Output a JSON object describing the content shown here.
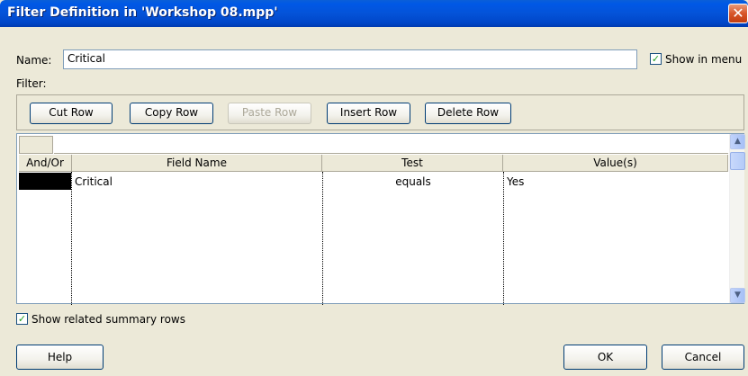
{
  "window": {
    "title": "Filter Definition in 'Workshop 08.mpp'",
    "close_symbol": "✕"
  },
  "name": {
    "label": "Name:",
    "value": "Critical"
  },
  "show_in_menu": {
    "label": "Show in menu",
    "checked": true
  },
  "filter_label": "Filter:",
  "toolbar": {
    "cut_row": "Cut Row",
    "copy_row": "Copy Row",
    "paste_row": "Paste Row",
    "insert_row": "Insert Row",
    "delete_row": "Delete Row"
  },
  "grid": {
    "columns": [
      "And/Or",
      "Field Name",
      "Test",
      "Value(s)"
    ],
    "rows": [
      {
        "and_or": "",
        "field_name": "Critical",
        "test": "equals",
        "value": "Yes"
      }
    ]
  },
  "show_related_summary_rows": {
    "label": "Show related summary rows",
    "checked": true
  },
  "buttons": {
    "help": "Help",
    "ok": "OK",
    "cancel": "Cancel"
  },
  "icons": {
    "check": "✓",
    "scroll_up": "▲",
    "scroll_down": "▼"
  }
}
